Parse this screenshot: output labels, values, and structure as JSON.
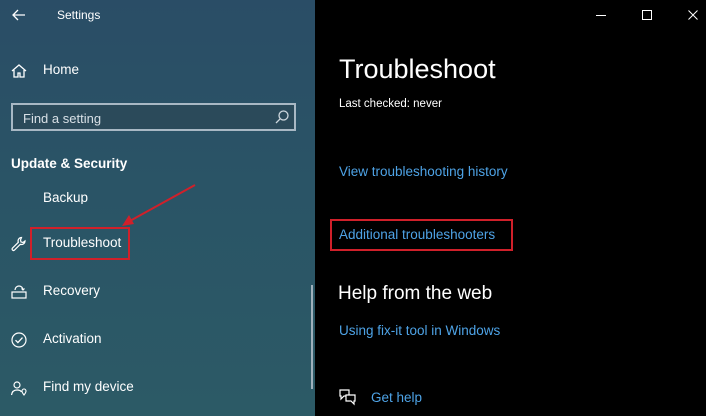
{
  "window": {
    "title": "Settings",
    "controls": {
      "minimize": "minimize-icon",
      "maximize": "maximize-icon",
      "close": "close-icon"
    }
  },
  "sidebar": {
    "home": {
      "label": "Home",
      "icon": "home-icon"
    },
    "search": {
      "placeholder": "Find a setting",
      "value": ""
    },
    "section_heading": "Update & Security",
    "items": [
      {
        "label": "Backup",
        "icon": "backup-icon"
      },
      {
        "label": "Troubleshoot",
        "icon": "wrench-icon"
      },
      {
        "label": "Recovery",
        "icon": "recovery-icon"
      },
      {
        "label": "Activation",
        "icon": "activation-icon"
      },
      {
        "label": "Find my device",
        "icon": "person-pin-icon"
      }
    ]
  },
  "main": {
    "title": "Troubleshoot",
    "last_checked": "Last checked: never",
    "links": {
      "history": "View troubleshooting history",
      "additional": "Additional troubleshooters"
    },
    "help": {
      "title": "Help from the web",
      "fixit": "Using fix-it tool in Windows",
      "get_help": "Get help"
    }
  },
  "colors": {
    "accent_link": "#4ea3e6",
    "highlight": "#d0202a",
    "sidebar_bg": "#2a5466",
    "main_bg": "#000000"
  }
}
